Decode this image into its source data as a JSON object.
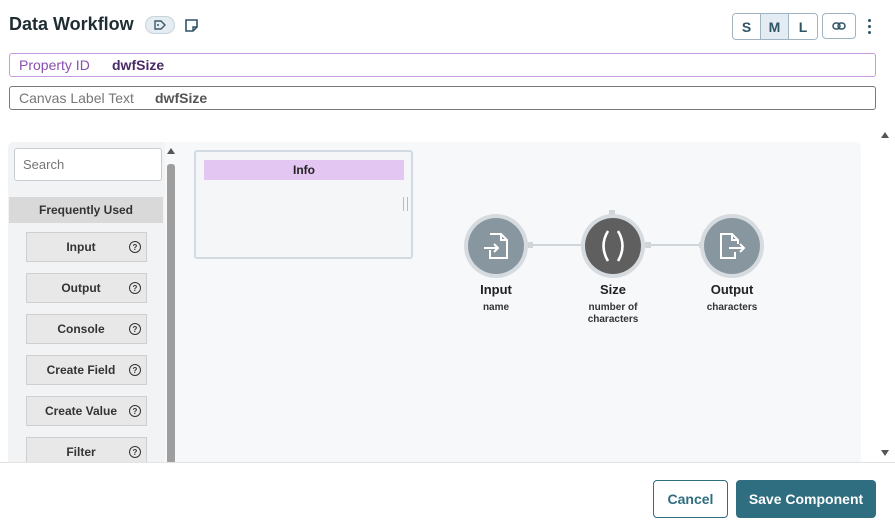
{
  "header": {
    "title": "Data Workflow",
    "tag_icon": "tag-icon",
    "note_icon": "note-icon",
    "size_options": [
      "S",
      "M",
      "L"
    ],
    "size_selected": "M",
    "link_icon": "link-icon",
    "more_icon": "more-vertical-icon"
  },
  "fields": {
    "property_id_label": "Property ID",
    "property_id_value": "dwfSize",
    "canvas_label_label": "Canvas Label Text",
    "canvas_label_value": "dwfSize"
  },
  "palette": {
    "search_placeholder": "Search",
    "section_title": "Frequently Used",
    "items": [
      {
        "label": "Input"
      },
      {
        "label": "Output"
      },
      {
        "label": "Console"
      },
      {
        "label": "Create Field"
      },
      {
        "label": "Create Value"
      },
      {
        "label": "Filter"
      }
    ]
  },
  "canvas": {
    "info_title": "Info",
    "nodes": [
      {
        "title": "Input",
        "subtitle": "name",
        "icon": "file-import-icon"
      },
      {
        "title": "Size",
        "subtitle": "number of characters",
        "icon": "parentheses-icon"
      },
      {
        "title": "Output",
        "subtitle": "characters",
        "icon": "file-export-icon"
      }
    ]
  },
  "footer": {
    "cancel_label": "Cancel",
    "save_label": "Save Component"
  },
  "colors": {
    "primary": "#2f6d80",
    "info_header": "#e4c6f2",
    "property_border": "#c89be0"
  }
}
